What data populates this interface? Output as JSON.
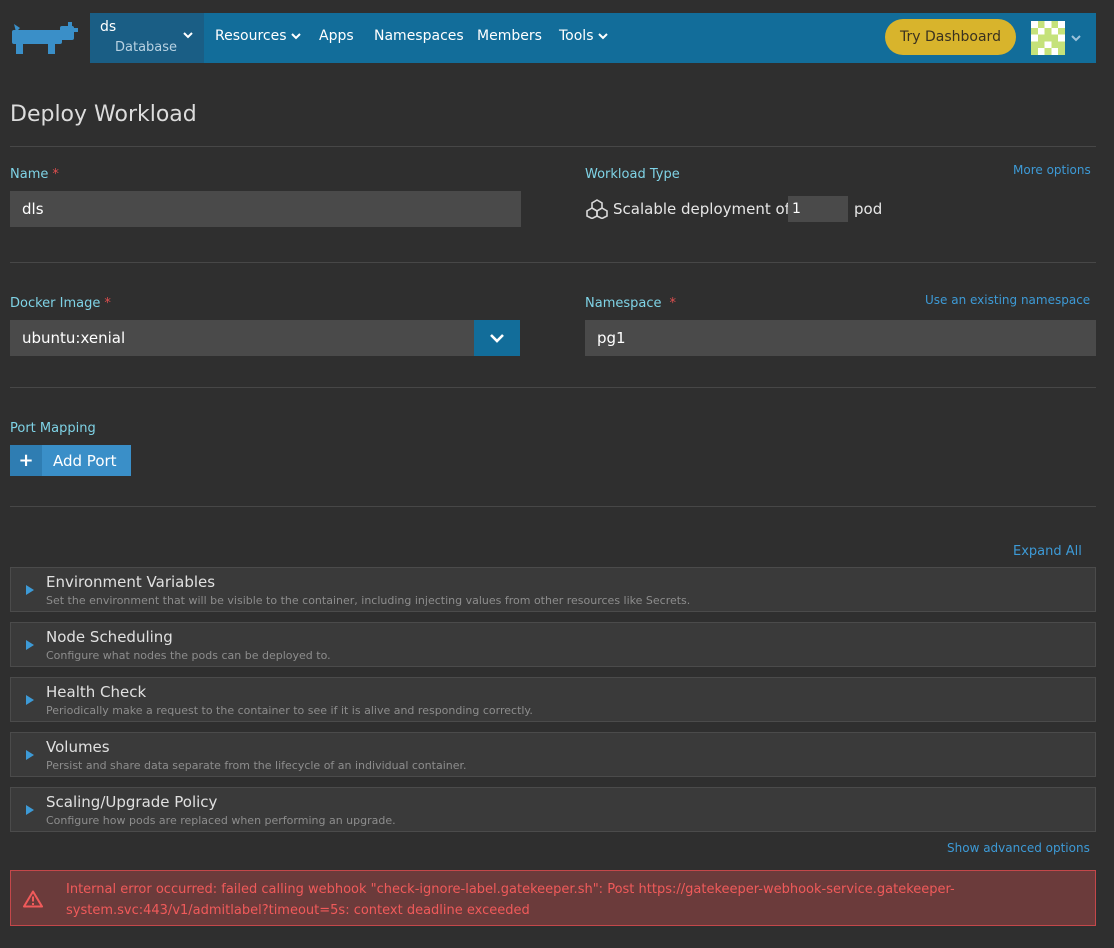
{
  "header": {
    "cluster_name": "ds",
    "cluster_sub": "Database",
    "nav": [
      "Resources",
      "Apps",
      "Namespaces",
      "Members",
      "Tools"
    ],
    "try_dashboard": "Try Dashboard"
  },
  "page": {
    "title": "Deploy Workload"
  },
  "form": {
    "name_label": "Name",
    "name_value": "dls",
    "workload_type_label": "Workload Type",
    "more_options": "More options",
    "workload_desc_pre": "Scalable deployment of",
    "scale_value": "1",
    "workload_desc_post": "pod",
    "docker_image_label": "Docker Image",
    "docker_image_value": "ubuntu:xenial",
    "namespace_label": "Namespace",
    "use_existing_namespace": "Use an existing namespace",
    "namespace_value": "pg1",
    "port_mapping_label": "Port Mapping",
    "add_port": "Add Port",
    "required_mark": "*"
  },
  "sections": {
    "expand_all": "Expand All",
    "items": [
      {
        "title": "Environment Variables",
        "desc": "Set the environment that will be visible to the container, including injecting values from other resources like Secrets."
      },
      {
        "title": "Node Scheduling",
        "desc": "Configure what nodes the pods can be deployed to."
      },
      {
        "title": "Health Check",
        "desc": "Periodically make a request to the container to see if it is alive and responding correctly."
      },
      {
        "title": "Volumes",
        "desc": "Persist and share data separate from the lifecycle of an individual container."
      },
      {
        "title": "Scaling/Upgrade Policy",
        "desc": "Configure how pods are replaced when performing an upgrade."
      }
    ],
    "show_advanced": "Show advanced options"
  },
  "error": {
    "message": "Internal error occurred: failed calling webhook \"check-ignore-label.gatekeeper.sh\": Post https://gatekeeper-webhook-service.gatekeeper-system.svc:443/v1/admitlabel?timeout=5s: context deadline exceeded"
  },
  "colors": {
    "nav_bg": "#126d9a",
    "accent_link": "#3d9ad6",
    "label": "#7fd3e6",
    "try_dashboard": "#d8b42c",
    "error_text": "#f05a5a",
    "error_bg": "#6b3b3b"
  },
  "icons": {
    "logo": "rancher-cow-logo",
    "workload": "cubes-icon",
    "error": "warning-triangle-icon"
  }
}
